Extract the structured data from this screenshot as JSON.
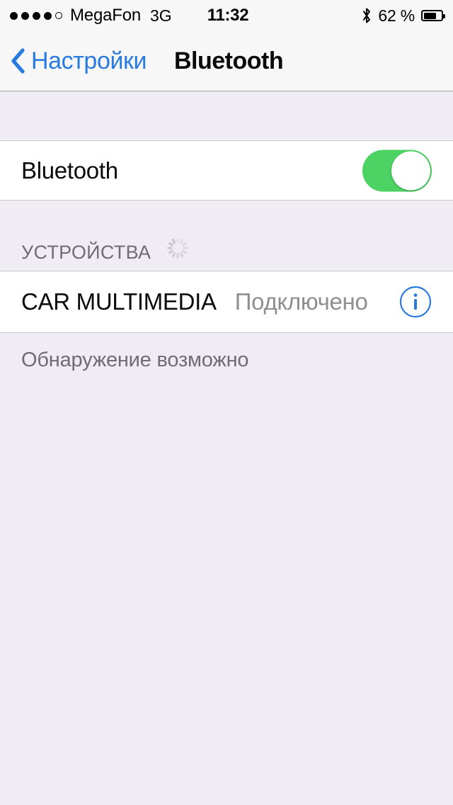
{
  "status_bar": {
    "signal_dots_filled": 4,
    "signal_dots_total": 5,
    "carrier": "MegaFon",
    "network": "3G",
    "time": "11:32",
    "bluetooth_icon": "bluetooth-icon",
    "battery_percent_label": "62 %",
    "battery_level": 62
  },
  "nav": {
    "back_icon": "chevron-left-icon",
    "back_label": "Настройки",
    "title": "Bluetooth"
  },
  "bluetooth_row": {
    "label": "Bluetooth",
    "toggle_state": "on",
    "toggle_color": "#4CD364"
  },
  "devices_section": {
    "header": "УСТРОЙСТВА",
    "spinner_icon": "activity-indicator-icon",
    "items": [
      {
        "name": "CAR MULTIMEDIA",
        "status": "Подключено",
        "info_icon": "info-circle-icon",
        "info_color": "#2A7BE0"
      }
    ]
  },
  "footer": {
    "note": "Обнаружение возможно"
  },
  "colors": {
    "accent_blue": "#2A7BE0",
    "page_background": "#EFEDF3",
    "cell_background": "#FFFFFF",
    "secondary_text": "#6D6D72"
  }
}
